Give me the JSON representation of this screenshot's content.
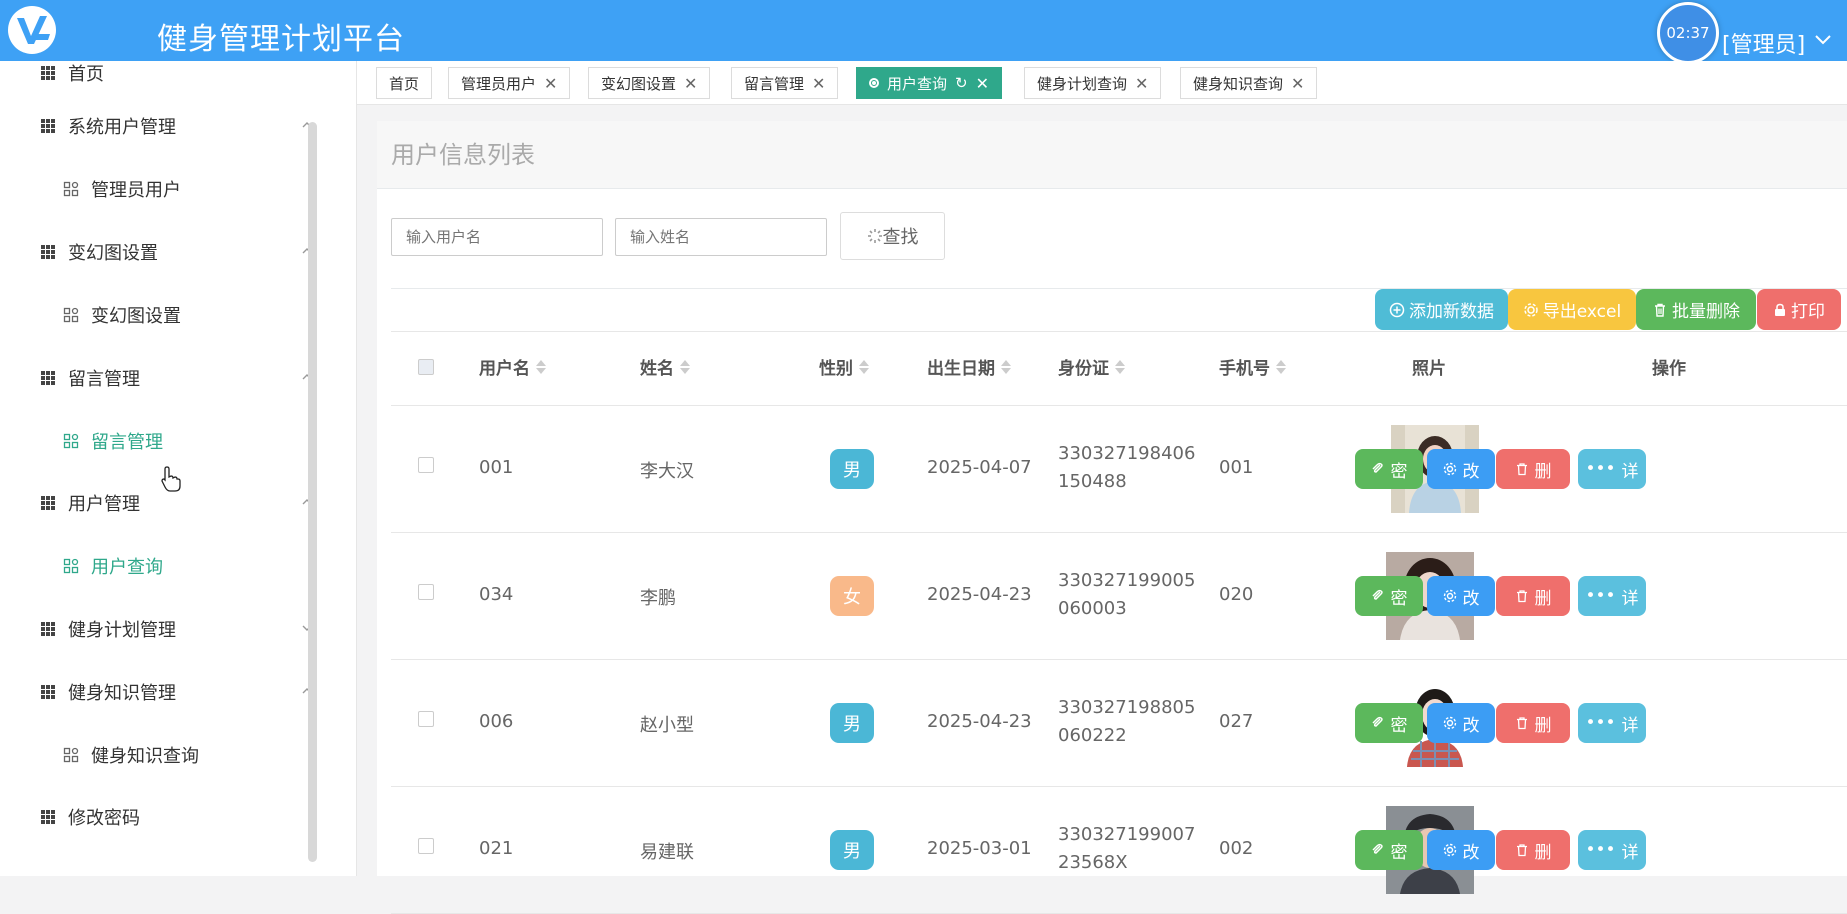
{
  "header": {
    "app_title": "健身管理计划平台",
    "clock_time": "02:37",
    "user_role": "[管理员]"
  },
  "sidebar": {
    "items": [
      {
        "label": "首页",
        "type": "group"
      },
      {
        "label": "系统用户管理",
        "type": "group"
      },
      {
        "label": "管理员用户",
        "type": "sub"
      },
      {
        "label": "变幻图设置",
        "type": "group"
      },
      {
        "label": "变幻图设置",
        "type": "sub"
      },
      {
        "label": "留言管理",
        "type": "group"
      },
      {
        "label": "留言管理",
        "type": "sub",
        "active": true
      },
      {
        "label": "用户管理",
        "type": "group"
      },
      {
        "label": "用户查询",
        "type": "sub",
        "active": true
      },
      {
        "label": "健身计划管理",
        "type": "group"
      },
      {
        "label": "健身知识管理",
        "type": "group"
      },
      {
        "label": "健身知识查询",
        "type": "sub"
      },
      {
        "label": "修改密码",
        "type": "group"
      }
    ]
  },
  "tabs": [
    {
      "label": "首页"
    },
    {
      "label": "管理员用户"
    },
    {
      "label": "变幻图设置"
    },
    {
      "label": "留言管理"
    },
    {
      "label": "用户查询",
      "active": true
    },
    {
      "label": "健身计划查询"
    },
    {
      "label": "健身知识查询"
    }
  ],
  "panel": {
    "title": "用户信息列表",
    "username_placeholder": "输入用户名",
    "name_placeholder": "输入姓名",
    "search_label": "查找"
  },
  "actions": {
    "add": "添加新数据",
    "export": "导出excel",
    "batch_delete": "批量删除",
    "print": "打印"
  },
  "table": {
    "headers": {
      "username": "用户名",
      "name": "姓名",
      "gender": "性别",
      "birth": "出生日期",
      "idcard": "身份证",
      "phone": "手机号",
      "photo": "照片",
      "ops": "操作"
    },
    "row_buttons": {
      "password": "密",
      "edit": "改",
      "delete": "删",
      "detail": "详"
    },
    "rows": [
      {
        "username": "001",
        "name": "李大汉",
        "gender": "男",
        "birth": "2025-04-07",
        "idcard": "330327198406150488",
        "phone": "001"
      },
      {
        "username": "034",
        "name": "李鹏",
        "gender": "女",
        "birth": "2025-04-23",
        "idcard": "330327199005060003",
        "phone": "020"
      },
      {
        "username": "006",
        "name": "赵小型",
        "gender": "男",
        "birth": "2025-04-23",
        "idcard": "330327198805060222",
        "phone": "027"
      },
      {
        "username": "021",
        "name": "易建联",
        "gender": "男",
        "birth": "2025-03-01",
        "idcard": "33032719900723568X",
        "phone": "002"
      }
    ]
  },
  "colors": {
    "header": "#3ea1f5",
    "accent": "#2fa88b",
    "male_badge": "#4bb7d6",
    "female_badge": "#f9b98a"
  }
}
